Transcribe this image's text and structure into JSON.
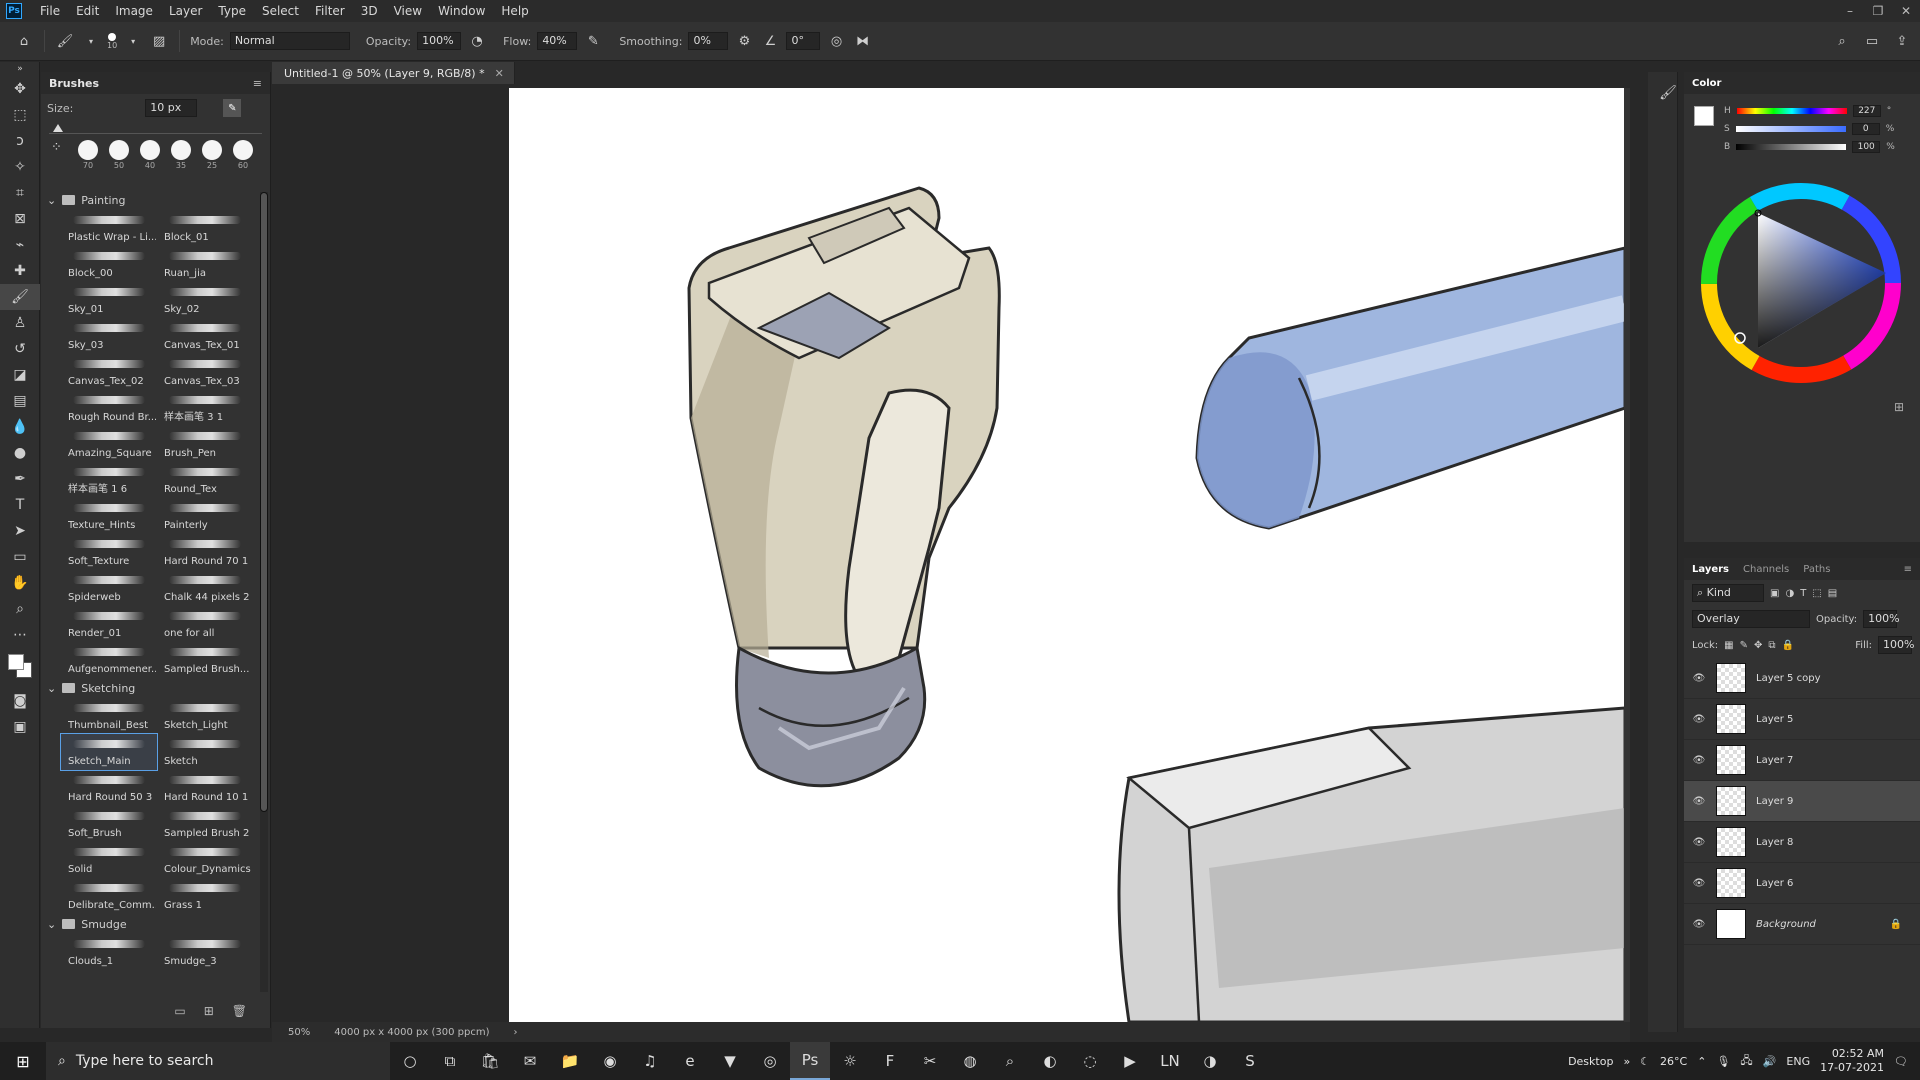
{
  "menubar": {
    "logo": "Ps",
    "items": [
      "File",
      "Edit",
      "Image",
      "Layer",
      "Type",
      "Select",
      "Filter",
      "3D",
      "View",
      "Window",
      "Help"
    ]
  },
  "options": {
    "brush_size_small": "10",
    "mode_label": "Mode:",
    "mode_value": "Normal",
    "opacity_label": "Opacity:",
    "opacity_value": "100%",
    "flow_label": "Flow:",
    "flow_value": "40%",
    "smoothing_label": "Smoothing:",
    "smoothing_value": "0%",
    "angle_value": "0°"
  },
  "brushes": {
    "tab": "Brushes",
    "size_label": "Size:",
    "size_value": "10 px",
    "presets": [
      "70",
      "50",
      "40",
      "35",
      "25",
      "60"
    ],
    "groups": [
      {
        "name": "Painting",
        "items": [
          "Plastic Wrap - Li...",
          "Block_01",
          "Block_00",
          "Ruan_jia",
          "Sky_01",
          "Sky_02",
          "Sky_03",
          "Canvas_Tex_01",
          "Canvas_Tex_02",
          "Canvas_Tex_03",
          "Rough Round Br...",
          "样本画笔 3 1",
          "Amazing_Square",
          "Brush_Pen",
          "样本画笔 1 6",
          "Round_Tex",
          "Texture_Hints",
          "Painterly",
          "Soft_Texture",
          "Hard Round 70 1",
          "Spiderweb",
          "Chalk 44 pixels 2",
          "Render_01",
          "one for all",
          "Aufgenommener...",
          "Sampled Brush..."
        ]
      },
      {
        "name": "Sketching",
        "items": [
          "Thumbnail_Best",
          "Sketch_Light",
          "Sketch_Main",
          "Sketch",
          "Hard Round 50 3",
          "Hard Round 10 1",
          "Soft_Brush",
          "Sampled Brush 2",
          "Solid",
          "Colour_Dynamics",
          "Delibrate_Comm...",
          "Grass 1"
        ]
      },
      {
        "name": "Smudge",
        "items": [
          "Clouds_1",
          "Smudge_3"
        ]
      }
    ],
    "selected": "Sketch_Main"
  },
  "document": {
    "tab_title": "Untitled-1 @ 50% (Layer 9, RGB/8) *",
    "zoom": "50%",
    "doc_info": "4000 px x 4000 px (300 ppcm)"
  },
  "color_panel": {
    "tab": "Color",
    "h_label": "H",
    "h_value": "227",
    "h_unit": "°",
    "s_label": "S",
    "s_value": "0",
    "s_unit": "%",
    "b_label": "B",
    "b_value": "100",
    "b_unit": "%"
  },
  "layers_panel": {
    "tabs": [
      "Layers",
      "Channels",
      "Paths"
    ],
    "kind_label": "Kind",
    "blend_mode": "Overlay",
    "opacity_label": "Opacity:",
    "opacity_value": "100%",
    "lock_label": "Lock:",
    "fill_label": "Fill:",
    "fill_value": "100%",
    "layers": [
      "Layer 5 copy",
      "Layer 5",
      "Layer 7",
      "Layer 9",
      "Layer 8",
      "Layer 6",
      "Background"
    ],
    "selected": "Layer 9"
  },
  "taskbar": {
    "search_placeholder": "Type here to search",
    "desktop_label": "Desktop",
    "temperature": "26°C",
    "language": "ENG",
    "time": "02:52 AM",
    "date": "17-07-2021"
  }
}
